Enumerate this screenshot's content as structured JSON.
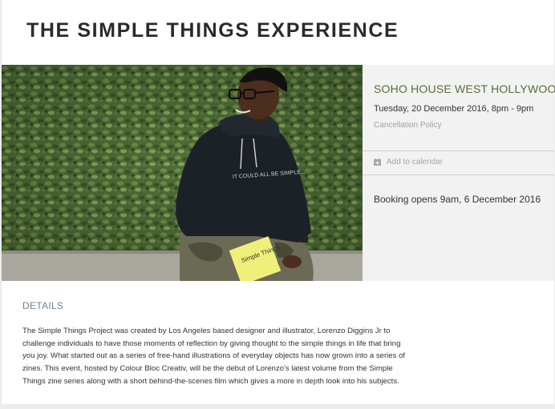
{
  "event": {
    "title": "THE SIMPLE THINGS EXPERIENCE",
    "image_icon": "event-hero-photo",
    "hoodie_text": "IT COULD ALL BE SIMPLE...",
    "book_text": "Simple Things"
  },
  "info_panel": {
    "venue": "SOHO HOUSE WEST HOLLYWOOD",
    "datetime": "Tuesday, 20 December 2016, 8pm - 9pm",
    "cancellation_link": "Cancellation Policy",
    "calendar_icon": "calendar-plus-icon",
    "add_to_calendar": "Add to calendar",
    "booking_opens": "Booking opens 9am, 6 December 2016"
  },
  "details": {
    "heading": "DETAILS",
    "lines": [
      "The Simple Things Project was created by Los Angeles based designer and illustrator, Lorenzo Diggins Jr to",
      "challenge individuals to have those moments of reflection by giving thought to the simple things in life that bring",
      "you joy. What started out as a series of free-hand illustrations of everyday objects has now grown into a series of",
      "zines. This event, hosted by Colour Bloc Creativ, will be the debut of Lorenzo's latest volume from the Simple",
      "Things zine series along with a short behind-the-scenes film which gives a more in depth look into his subjects."
    ]
  },
  "colors": {
    "venue": "#5b6b3a",
    "panel_bg": "#f2f2f2",
    "details_heading": "#6f7f91"
  }
}
